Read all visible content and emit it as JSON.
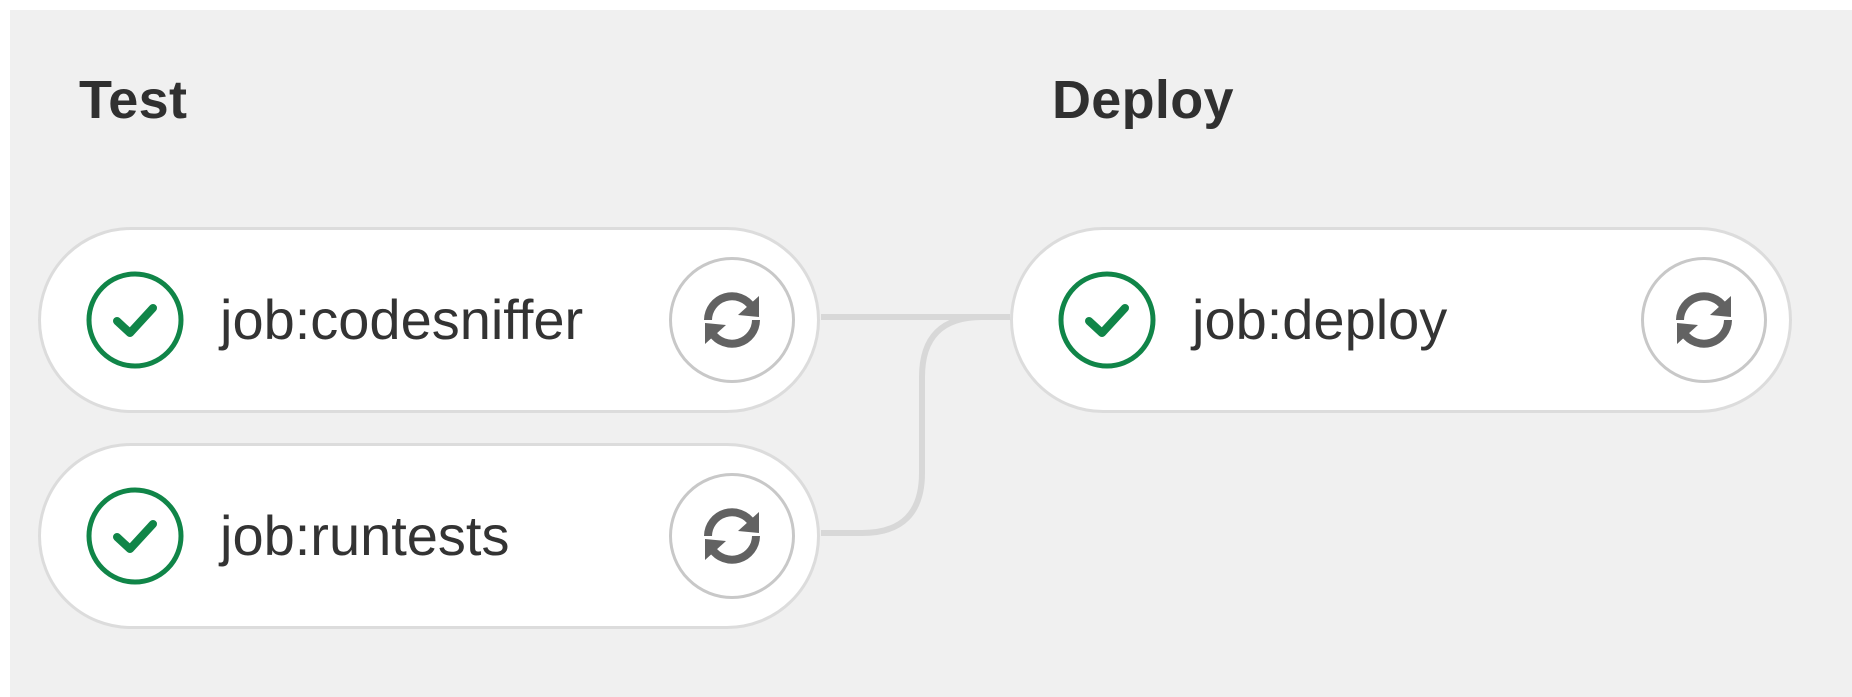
{
  "stages": [
    {
      "title": "Test",
      "jobs": [
        {
          "name": "job:codesniffer",
          "status": "success",
          "status_icon": "check-circle-icon",
          "action_icon": "retry-icon"
        },
        {
          "name": "job:runtests",
          "status": "success",
          "status_icon": "check-circle-icon",
          "action_icon": "retry-icon"
        }
      ]
    },
    {
      "title": "Deploy",
      "jobs": [
        {
          "name": "job:deploy",
          "status": "success",
          "status_icon": "check-circle-icon",
          "action_icon": "retry-icon"
        }
      ]
    }
  ],
  "colors": {
    "success": "#108548",
    "icon_gray": "#626262",
    "connector": "#d8d8d8",
    "background": "#f0f0f0"
  }
}
